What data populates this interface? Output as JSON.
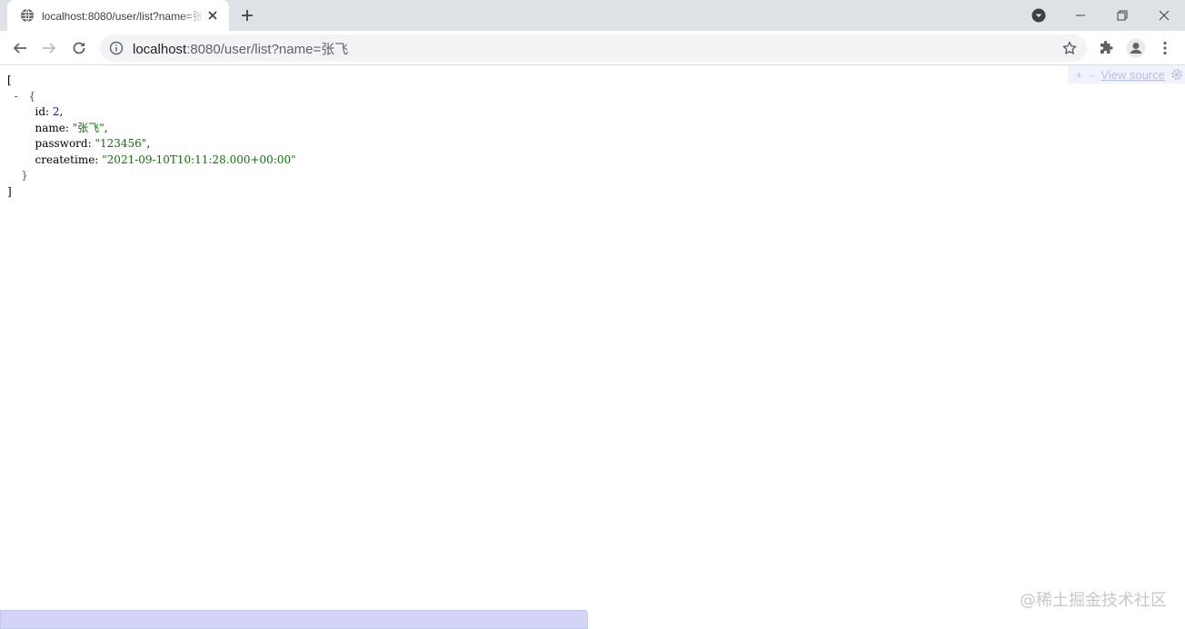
{
  "browser": {
    "tab": {
      "title": "localhost:8080/user/list?name=张飞",
      "favicon": "globe-icon",
      "close": "close-icon"
    },
    "new_tab": "plus-icon",
    "window_controls": [
      "minimize-icon",
      "restore-icon",
      "close-icon"
    ],
    "tab_search": "chevron-down-circle-icon",
    "toolbar": {
      "back": "arrow-left-icon",
      "forward": "arrow-right-icon",
      "reload": "reload-icon",
      "site_info": "info-icon",
      "url_host": "localhost",
      "url_rest": ":8080/user/list?name=张飞",
      "bookmark": "star-icon",
      "extensions": "puzzle-icon",
      "profile": "avatar-icon",
      "menu": "kebab-menu-icon"
    }
  },
  "json_viewer": {
    "open_bracket": "[",
    "close_bracket": "]",
    "collapser": "-",
    "open_brace": "{",
    "close_brace": "}",
    "entries": [
      {
        "key": "id",
        "value": "2",
        "type": "number"
      },
      {
        "key": "name",
        "value": "\"张飞\"",
        "type": "string"
      },
      {
        "key": "password",
        "value": "\"123456\"",
        "type": "string"
      },
      {
        "key": "createtime",
        "value": "\"2021-09-10T10:11:28.000+00:00\"",
        "type": "string"
      }
    ],
    "tools": {
      "expand": "+",
      "collapse": "-",
      "view_source": "View source",
      "settings": "gear-icon"
    }
  },
  "watermark": "@稀土掘金技术社区",
  "colors": {
    "tabstrip": "#dee1e6",
    "number": "#1a1aa6",
    "string": "#0b7500",
    "status_bar": "#d3d4f6"
  }
}
